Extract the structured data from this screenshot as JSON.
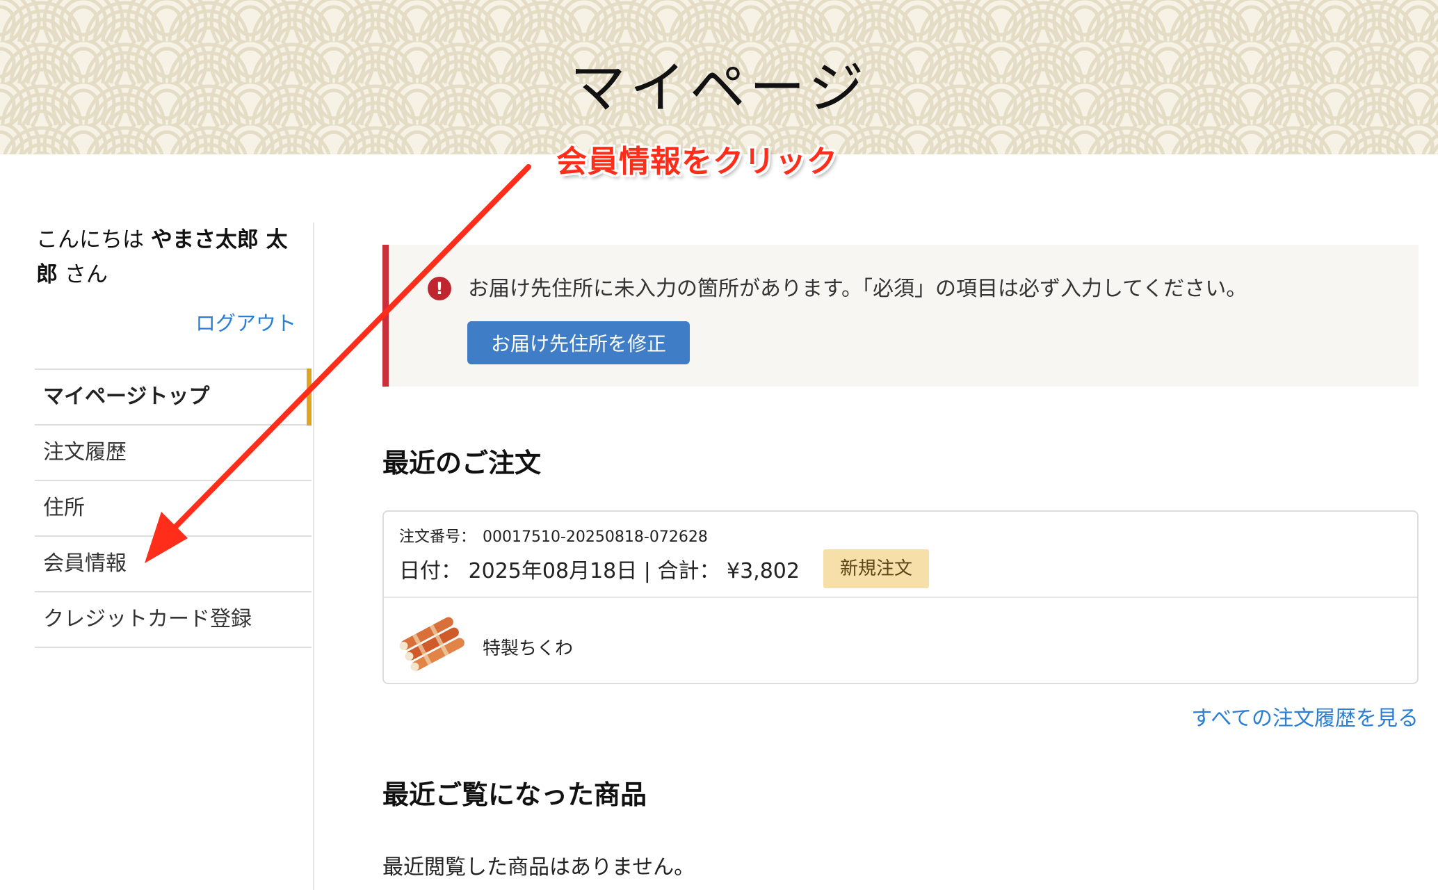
{
  "header": {
    "title": "マイページ"
  },
  "annotation": {
    "text": "会員情報をクリック",
    "color": "#ff2d1a"
  },
  "sidebar": {
    "greeting_prefix": "こんにちは",
    "user_name": "やまさ太郎 太郎",
    "greeting_suffix": "さん",
    "logout_label": "ログアウト",
    "nav_items": [
      {
        "label": "マイページトップ",
        "active": true
      },
      {
        "label": "注文履歴",
        "active": false
      },
      {
        "label": "住所",
        "active": false
      },
      {
        "label": "会員情報",
        "active": false
      },
      {
        "label": "クレジットカード登録",
        "active": false
      }
    ]
  },
  "alert": {
    "icon": "exclamation-circle-icon",
    "message": "お届け先住所に未入力の箇所があります。「必須」の項目は必ず入力してください。",
    "button_label": "お届け先住所を修正"
  },
  "recent_orders": {
    "title": "最近のご注文",
    "order": {
      "number_label": "注文番号：",
      "number": "00017510-20250818-072628",
      "date_label": "日付：",
      "date": "2025年08月18日",
      "separator": "|",
      "total_label": "合計：",
      "total": "¥3,802",
      "status": "新規注文",
      "product_name": "特製ちくわ"
    },
    "all_link": "すべての注文履歴を見る"
  },
  "recently_viewed": {
    "title": "最近ご覧になった商品",
    "empty_message": "最近閲覧した商品はありません。"
  },
  "colors": {
    "accent_link": "#2a7fd4",
    "alert_border": "#c9303b",
    "button": "#3f7ec6",
    "badge": "#f6dfa8",
    "nav_active_marker": "#e0a520",
    "header_pattern": "#f6f2e6"
  }
}
